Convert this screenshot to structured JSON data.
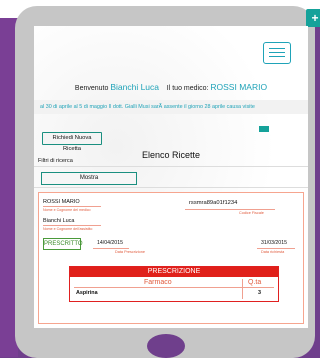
{
  "header": {
    "welcome_prefix": "Benvenuto",
    "user_name": "Bianchi Luca",
    "doctor_prefix": "Il tuo medico:",
    "doctor_name": "ROSSI MARIO"
  },
  "ticker": {
    "text": "al 30 di aprile al 5 di maggio    Il dott. Gialli Musi sarÃ  assente il giorno 28 aprile causa visite"
  },
  "actions": {
    "new_prescription": "Richiedi Nuova Ricetta",
    "show": "Mostra"
  },
  "list": {
    "title": "Elenco Ricette",
    "filters_label": "Filtri di ricerca"
  },
  "prescription": {
    "doctor_name": "ROSSI MARIO",
    "doctor_caption": "Nome e Cognome del medico",
    "patient_name": "Bianchi Luca",
    "patient_caption": "Nome e Cognome dell'assistito",
    "fiscal_code": "rssmra89a01f1234",
    "fiscal_caption": "Codice Fiscale",
    "status": "PRESCRITTO",
    "prescription_date": "14/04/2015",
    "prescription_date_caption": "Data Prescrizione",
    "request_date": "31/03/2015",
    "request_date_caption": "Data richiesta",
    "section_title": "PRESCRIZIONE",
    "col_drug": "Farmaco",
    "col_qty": "Q.ta",
    "items": [
      {
        "drug": "Aspirina",
        "qty": "3"
      }
    ]
  },
  "colors": {
    "background": "#6f3f8c",
    "tablet": "#c6c6c6",
    "accent": "#1fa3b8",
    "alert": "#e0201a",
    "status": "#3a8a2a"
  },
  "icons": {
    "menu": "hamburger-menu-icon",
    "add": "plus-icon"
  }
}
